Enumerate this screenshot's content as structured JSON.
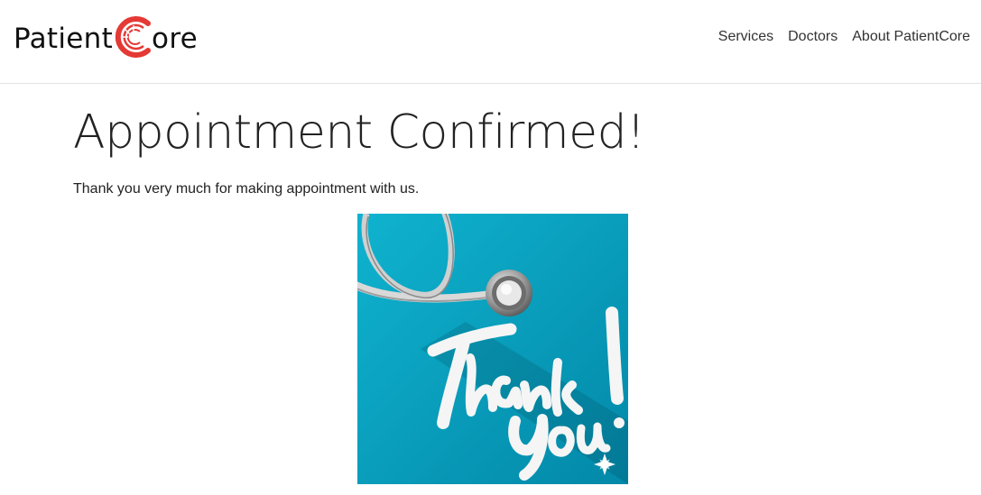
{
  "brand": {
    "name_part1": "Patient",
    "name_part2": "ore",
    "logo_color": "#e53935"
  },
  "nav": {
    "items": [
      {
        "label": "Services"
      },
      {
        "label": "Doctors"
      },
      {
        "label": "About PatientCore"
      }
    ]
  },
  "main": {
    "title": "Appointment Confirmed!",
    "message": "Thank you very much for making appointment with us.",
    "image": {
      "icon": "thank-you-stethoscope-image",
      "background_color": "#0aa3bf"
    }
  }
}
